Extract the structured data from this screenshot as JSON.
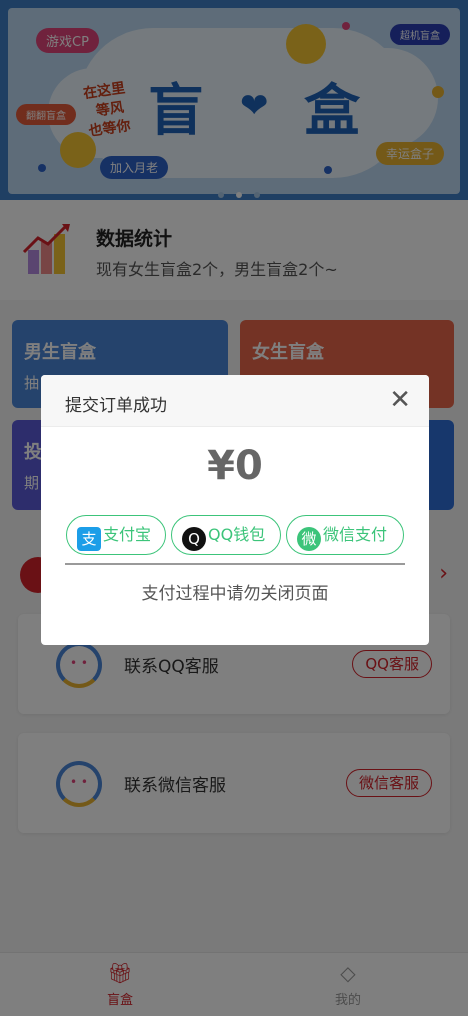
{
  "banner": {
    "tag_cp": "游戏CP",
    "tag_super": "超机盲盒",
    "tag_flip": "翻翻盲盒",
    "slogan_lines": [
      "在这里",
      "等风",
      "也等你"
    ],
    "title_left": "盲",
    "title_right": "盒",
    "tag_join": "加入月老",
    "tag_luck": "幸运盒子",
    "colors": {
      "frame": "#3f7fc6",
      "sky": "#bcd9f2",
      "cloud": "#eaf4fc",
      "title": "#1e63b8"
    }
  },
  "stats": {
    "title": "数据统计",
    "subtitle": "现有女生盲盒2个，男生盲盒2个~"
  },
  "cards": {
    "male": {
      "title": "男生盲盒",
      "sub": "抽"
    },
    "female": {
      "title": "女生盲盒"
    },
    "put": {
      "title": "投",
      "sub": "期"
    }
  },
  "services": [
    {
      "label": "联系QQ客服",
      "button": "QQ客服"
    },
    {
      "label": "联系微信客服",
      "button": "微信客服"
    }
  ],
  "tabbar": {
    "items": [
      {
        "label": "盲盒",
        "icon": "gift-icon",
        "active": true
      },
      {
        "label": "我的",
        "icon": "diamond-icon",
        "active": false
      }
    ]
  },
  "modal": {
    "title": "提交订单成功",
    "amount": "¥0",
    "pay_options": [
      {
        "label": "支付宝",
        "icon": "alipay-icon",
        "glyph": "支"
      },
      {
        "label": "QQ钱包",
        "icon": "qq-icon",
        "glyph": "Q"
      },
      {
        "label": "微信支付",
        "icon": "wechat-icon",
        "glyph": "微"
      }
    ],
    "note": "支付过程中请勿关闭页面",
    "accent": "#3cc47a"
  },
  "theme": {
    "primary": "#d4222a"
  }
}
